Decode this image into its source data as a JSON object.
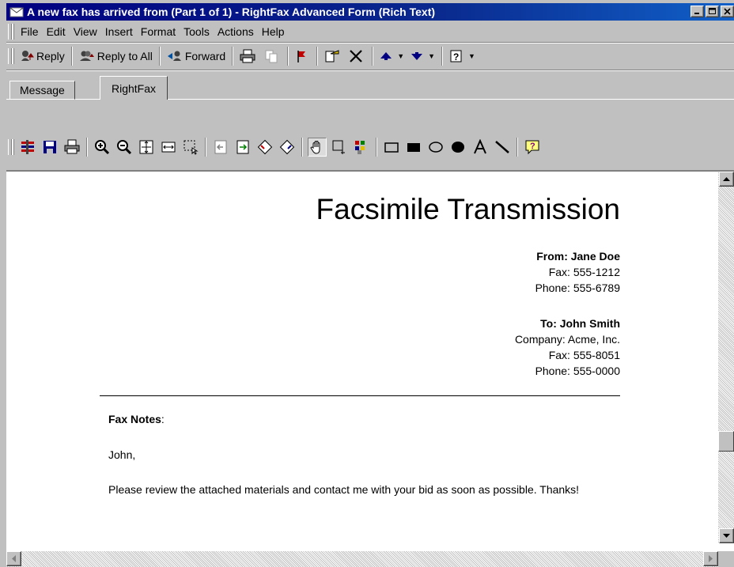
{
  "window": {
    "title": "A new fax has arrived from  (Part 1 of 1) - RightFax Advanced Form (Rich Text)"
  },
  "menu": [
    "File",
    "Edit",
    "View",
    "Insert",
    "Format",
    "Tools",
    "Actions",
    "Help"
  ],
  "toolbar": {
    "reply": "Reply",
    "reply_all": "Reply to All",
    "forward": "Forward"
  },
  "tabs": [
    "Message",
    "RightFax"
  ],
  "fax": {
    "heading": "Facsimile Transmission",
    "from": {
      "name_line": "From: Jane Doe",
      "fax": "Fax: 555-1212",
      "phone": "Phone: 555-6789"
    },
    "to": {
      "name_line": "To: John Smith",
      "company": "Company: Acme, Inc.",
      "fax": "Fax: 555-8051",
      "phone": "Phone: 555-0000"
    },
    "notes_label": "Fax Notes",
    "notes_colon": ":",
    "greeting": "John,",
    "body": "Please review the attached materials and contact me with your bid as soon as possible. Thanks!"
  },
  "colors": {
    "titlebar_start": "#000080",
    "titlebar_end": "#1060c8",
    "chrome": "#c0c0c0"
  }
}
